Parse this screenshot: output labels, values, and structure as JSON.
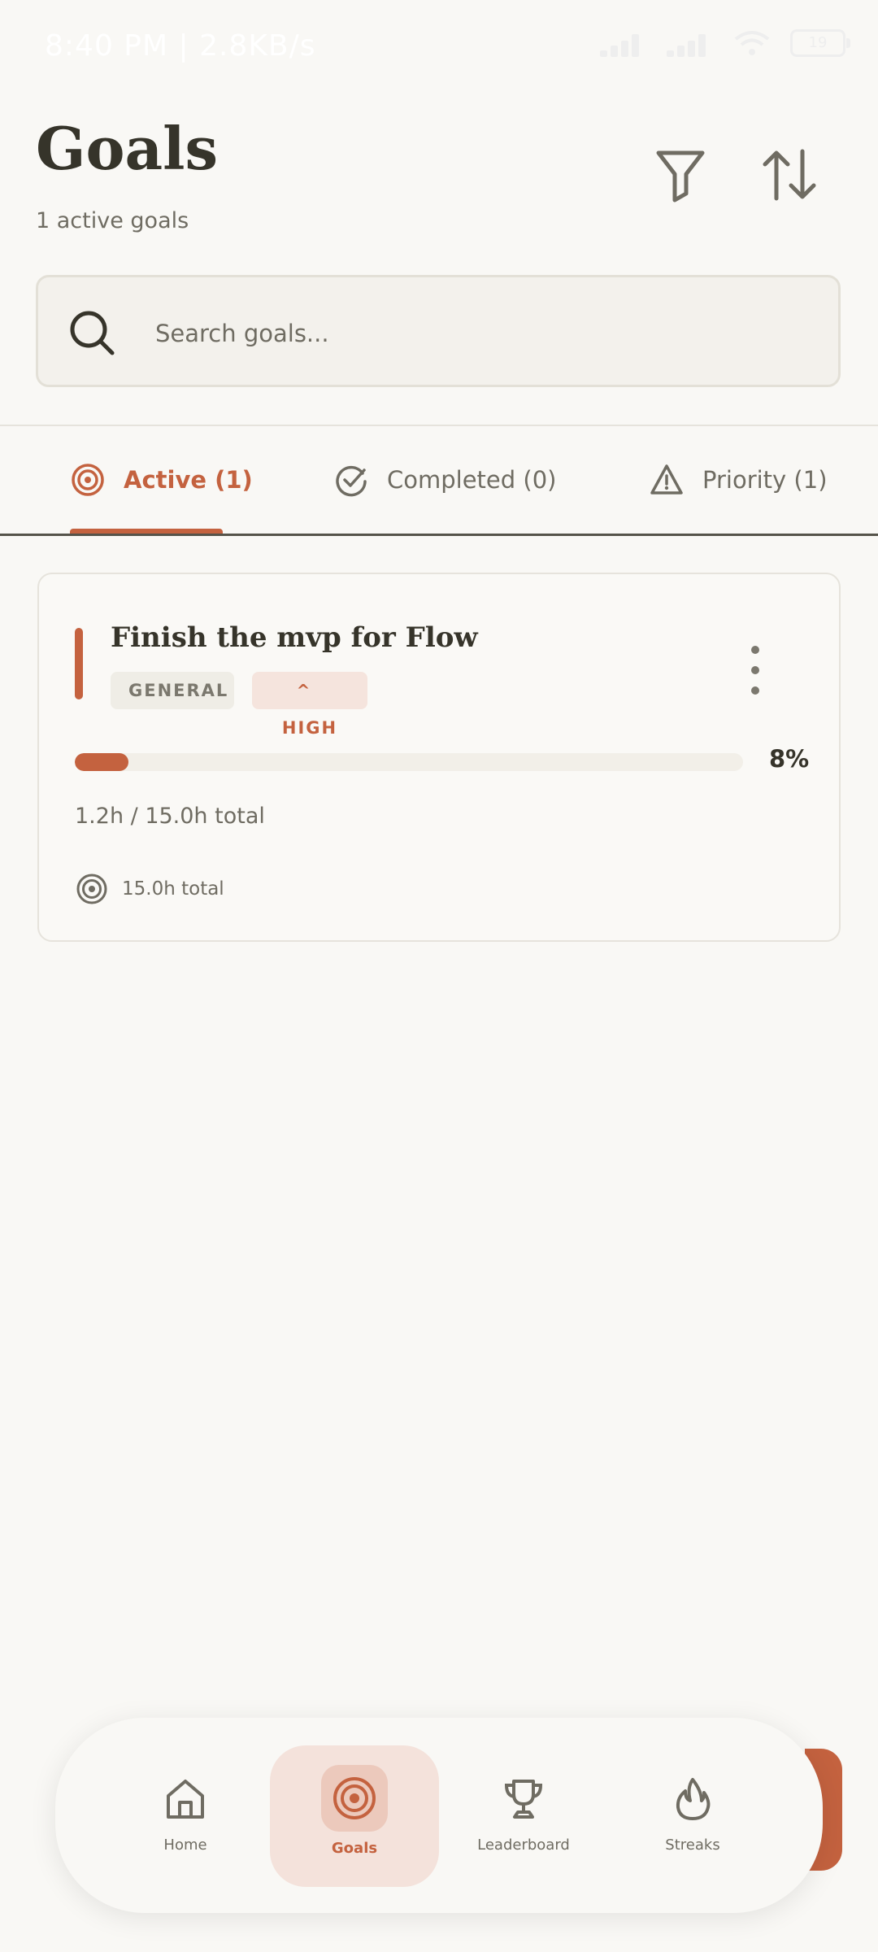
{
  "status_bar": {
    "time_speed": "8:40 PM | 2.8KB/s",
    "battery": "19"
  },
  "header": {
    "title": "Goals",
    "subtitle": "1 active goals"
  },
  "search": {
    "placeholder": "Search goals..."
  },
  "tabs": [
    {
      "label": "Active (1)",
      "icon": "target-icon",
      "active": true
    },
    {
      "label": "Completed (0)",
      "icon": "check-circle-icon",
      "active": false
    },
    {
      "label": "Priority (1)",
      "icon": "warning-icon",
      "active": false
    }
  ],
  "goal": {
    "title": "Finish the mvp for Flow",
    "category": "GENERAL",
    "priority": "HIGH",
    "progress_percent": 8,
    "progress_label": "8%",
    "time_summary": "1.2h / 15.0h total",
    "target_label": "15.0h total"
  },
  "nav": [
    {
      "label": "Home",
      "icon": "home-icon"
    },
    {
      "label": "Goals",
      "icon": "target-icon"
    },
    {
      "label": "Leaderboard",
      "icon": "trophy-icon"
    },
    {
      "label": "Streaks",
      "icon": "flame-icon"
    }
  ],
  "colors": {
    "accent": "#c4623f",
    "text": "#36342a",
    "muted": "#6f6c62",
    "background": "#f9f8f5"
  }
}
